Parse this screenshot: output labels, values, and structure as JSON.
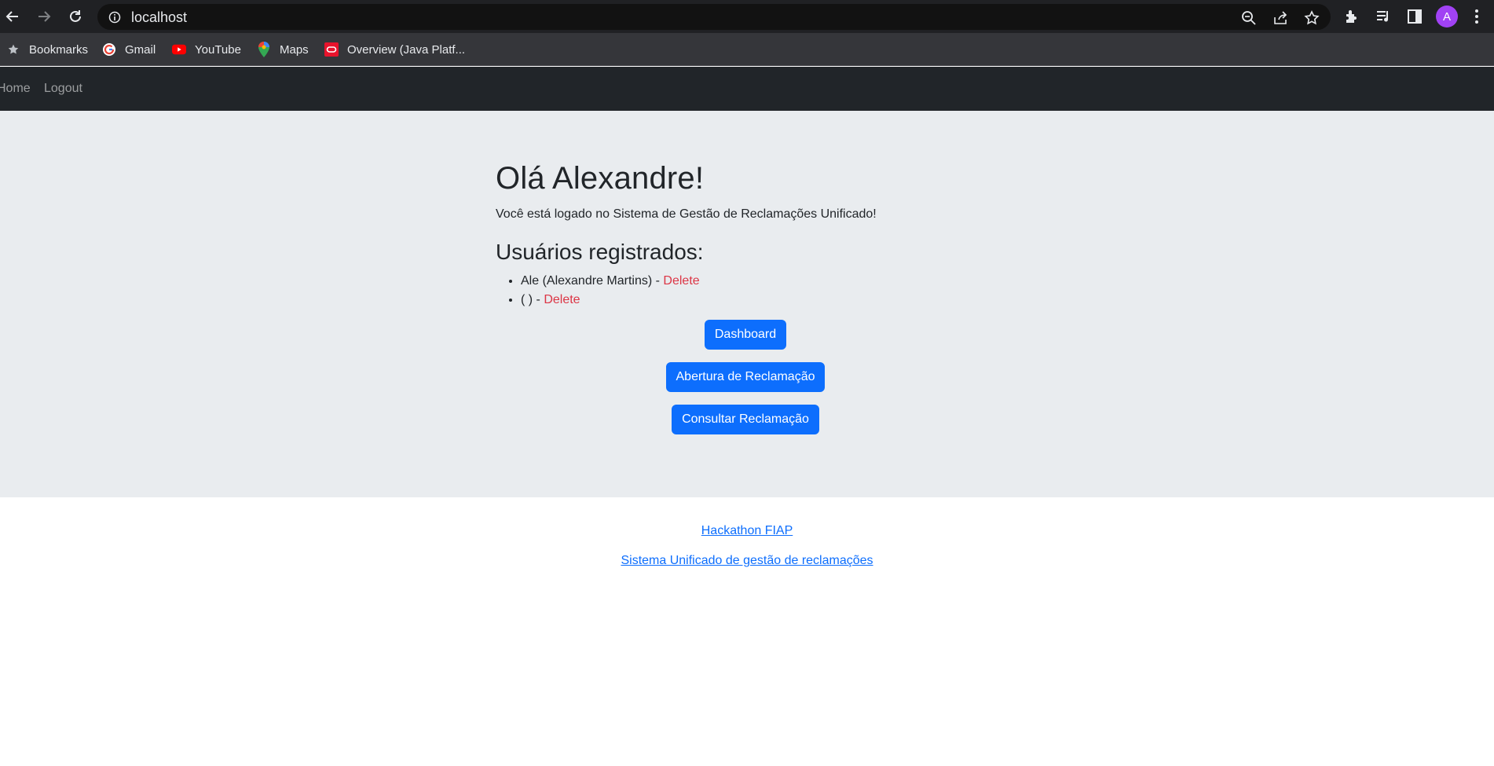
{
  "browser": {
    "url": "localhost",
    "profile_initial": "A",
    "bookmarks": [
      {
        "label": "Bookmarks",
        "icon": "star-icon"
      },
      {
        "label": "Gmail",
        "icon": "google-icon"
      },
      {
        "label": "YouTube",
        "icon": "youtube-icon"
      },
      {
        "label": "Maps",
        "icon": "maps-icon"
      },
      {
        "label": "Overview (Java Platf...",
        "icon": "oracle-icon"
      }
    ]
  },
  "navbar": {
    "home_label": "Home",
    "logout_label": "Logout"
  },
  "main": {
    "greeting": "Olá Alexandre!",
    "subtitle": "Você está logado no Sistema de Gestão de Reclamações Unificado!",
    "users_heading": "Usuários registrados:",
    "users": [
      {
        "display": "Ale (Alexandre Martins) -",
        "delete_label": "Delete"
      },
      {
        "display": "( ) -",
        "delete_label": "Delete"
      }
    ],
    "buttons": {
      "dashboard": "Dashboard",
      "abertura": "Abertura de Reclamação",
      "consultar": "Consultar Reclamação"
    }
  },
  "footer": {
    "link1": "Hackathon FIAP",
    "link2": "Sistema Unificado de gestão de reclamações"
  },
  "colors": {
    "primary": "#0d6efd",
    "danger": "#dc3545",
    "navbar_bg": "#212529",
    "main_bg": "#e9ecef",
    "avatar": "#a142f4"
  }
}
